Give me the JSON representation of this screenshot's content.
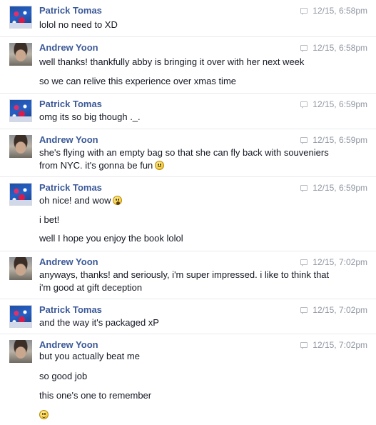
{
  "groups": [
    {
      "sender": "Patrick Tomas",
      "time": "12/15, 6:58pm",
      "messages": [
        "lolol no need to XD"
      ]
    },
    {
      "sender": "Andrew Yoon",
      "time": "12/15, 6:58pm",
      "messages": [
        "well thanks! thankfully abby is bringing it over with her next week",
        "so we can relive this experience over xmas time"
      ]
    },
    {
      "sender": "Patrick Tomas",
      "time": "12/15, 6:59pm",
      "messages": [
        "omg its so big though ._."
      ]
    },
    {
      "sender": "Andrew Yoon",
      "time": "12/15, 6:59pm",
      "messages": [
        "she's flying with an empty bag so that she can fly back with souveniers",
        "from NYC. it's gonna be fun"
      ],
      "emojis": {
        "m1": "flat-face-emoji"
      }
    },
    {
      "sender": "Patrick Tomas",
      "time": "12/15, 6:59pm",
      "messages": [
        "oh nice! and wow",
        "i bet!",
        "well I hope you enjoy the book lolol"
      ],
      "emojis": {
        "m0": "gasp-face-emoji"
      }
    },
    {
      "sender": "Andrew Yoon",
      "time": "12/15, 7:02pm",
      "messages": [
        "anyways, thanks! and seriously, i'm super impressed. i like to think that",
        "i'm good at gift deception"
      ]
    },
    {
      "sender": "Patrick Tomas",
      "time": "12/15, 7:02pm",
      "messages": [
        "and the way it's packaged xP"
      ]
    },
    {
      "sender": "Andrew Yoon",
      "time": "12/15, 7:02pm",
      "messages": [
        "but you actually beat me",
        "so good job",
        "this one's one to remember"
      ],
      "emojis": {
        "m3": "smile-face-emoji"
      }
    }
  ],
  "icons": {
    "timestamp": "chat-bubble-icon",
    "avatar_patrick": "patrick-avatar",
    "avatar_andrew": "andrew-avatar"
  },
  "colors": {
    "sender_name": "#3b5998",
    "timestamp": "#9197a3",
    "text": "#141823",
    "divider": "#e9eaed"
  }
}
